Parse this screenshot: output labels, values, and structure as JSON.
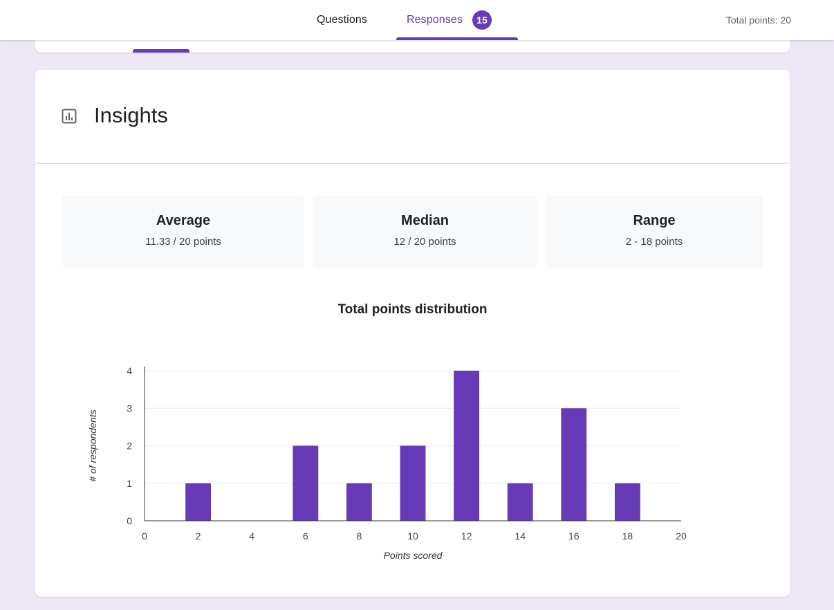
{
  "tabs": {
    "questions": "Questions",
    "responses": "Responses",
    "responses_count": "15",
    "total_points": "Total points: 20"
  },
  "insights": {
    "title": "Insights"
  },
  "stats": [
    {
      "label": "Average",
      "value": "11.33 / 20 points"
    },
    {
      "label": "Median",
      "value": "12 / 20 points"
    },
    {
      "label": "Range",
      "value": "2 - 18 points"
    }
  ],
  "colors": {
    "accent": "#673ab7",
    "background": "#ede7f6"
  },
  "chart_data": {
    "type": "bar",
    "title": "Total points distribution",
    "xlabel": "Points scored",
    "ylabel": "# of respondents",
    "x": [
      2,
      6,
      8,
      10,
      12,
      14,
      16,
      18
    ],
    "values": [
      1,
      2,
      1,
      2,
      4,
      1,
      3,
      1
    ],
    "xlim": [
      0,
      20
    ],
    "ylim": [
      0,
      4
    ],
    "xticks": [
      0,
      2,
      4,
      6,
      8,
      10,
      12,
      14,
      16,
      18,
      20
    ],
    "yticks": [
      0,
      1,
      2,
      3,
      4
    ],
    "grid": true,
    "legend": "none",
    "bar_color": "#673ab7"
  }
}
